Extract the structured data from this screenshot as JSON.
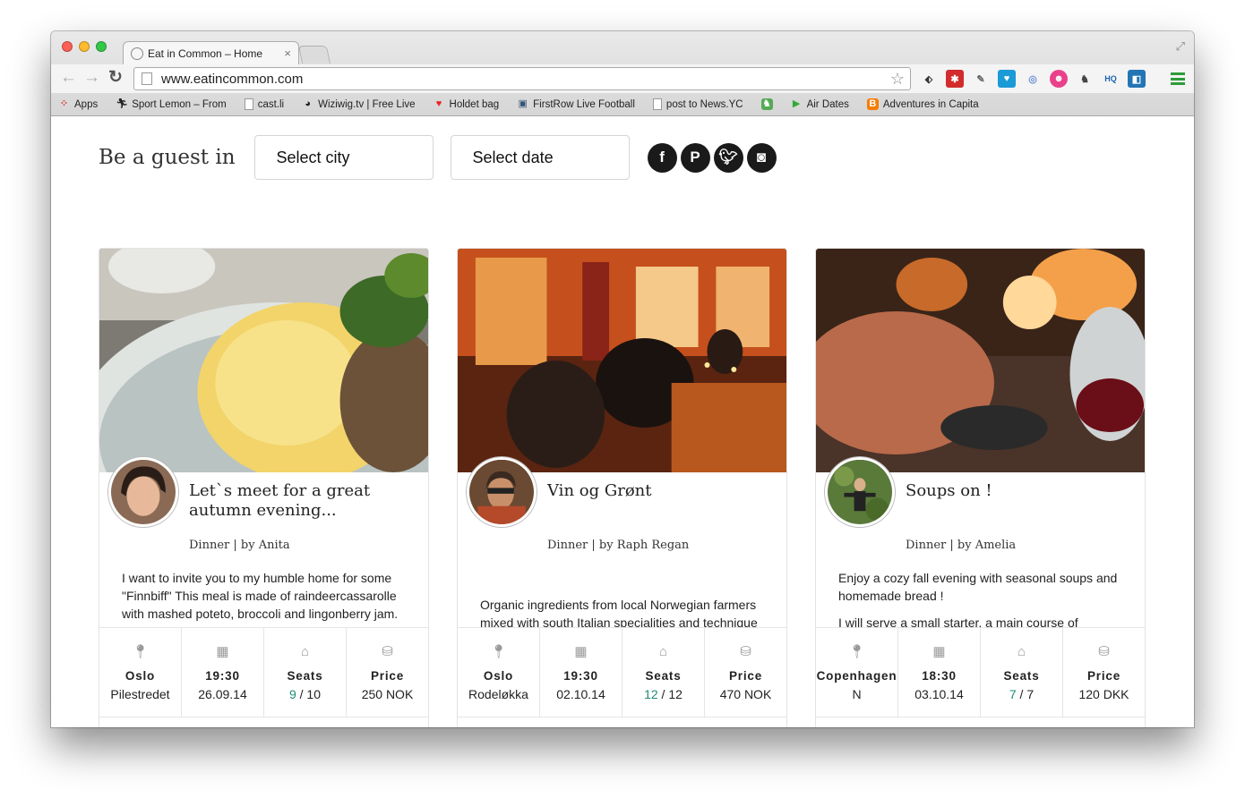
{
  "browser": {
    "tab_title": "Eat in Common – Home",
    "tab_close": "×",
    "url": "www.eatincommon.com",
    "bookmarks": [
      {
        "icon": "apps-grid-icon",
        "label": "Apps"
      },
      {
        "icon": "runner-icon",
        "label": "Sport Lemon – From"
      },
      {
        "icon": "page-icon",
        "label": "cast.li"
      },
      {
        "icon": "wiziwig-icon",
        "label": "Wiziwig.tv | Free Live"
      },
      {
        "icon": "heart-icon",
        "label": "Holdet bag"
      },
      {
        "icon": "monitor-icon",
        "label": "FirstRow Live Football"
      },
      {
        "icon": "page-icon",
        "label": "post to News.YC"
      },
      {
        "icon": "evernote-icon",
        "label": ""
      },
      {
        "icon": "play-icon",
        "label": "Air Dates"
      },
      {
        "icon": "blogger-icon",
        "label": "Adventures in Capita"
      }
    ]
  },
  "hero": {
    "guest_label": "Be a guest in",
    "city_select": "Select city",
    "date_select": "Select date",
    "social": [
      "facebook-icon",
      "pinterest-icon",
      "twitter-icon",
      "instagram-icon"
    ]
  },
  "cards": [
    {
      "title": "Let`s meet for a great autumn evening...",
      "meal": "Dinner",
      "host": "by Anita",
      "desc": [
        "I want to invite you to my humble home for  some \"Finnbiff\"  This  meal is made of raindeercassarolle with mashed poteto, broccoli and lingonberry jam."
      ],
      "city": "Oslo",
      "area": "Pilestredet",
      "time": "19:30",
      "date": "26.09.14",
      "seats_label": "Seats",
      "seats_taken": "9",
      "seats_total": "/ 10",
      "price_label": "Price",
      "price": "250 NOK"
    },
    {
      "title": "Vin og Grønt",
      "meal": "Dinner",
      "host": "by Raph Regan",
      "desc": [
        "Organic ingredients from local Norwegian farmers mixed with south Italian specialities and technique"
      ],
      "city": "Oslo",
      "area": "Rodeløkka",
      "time": "19:30",
      "date": "02.10.14",
      "seats_label": "Seats",
      "seats_taken": "12",
      "seats_total": "/ 12",
      "price_label": "Price",
      "price": "470 NOK"
    },
    {
      "title": "Soups on !",
      "meal": "Dinner",
      "host": "by Amelia",
      "desc": [
        "Enjoy a cozy fall evening with seasonal soups and homemade bread !",
        "I will serve a small starter, a main course of"
      ],
      "city": "Copenhagen",
      "area": "N",
      "time": "18:30",
      "date": "03.10.14",
      "seats_label": "Seats",
      "seats_taken": "7",
      "seats_total": "/ 7",
      "price_label": "Price",
      "price": "120 DKK"
    }
  ],
  "colors": {
    "seats_accent": "#1e8a78",
    "social_bg": "#1a1a1a"
  }
}
